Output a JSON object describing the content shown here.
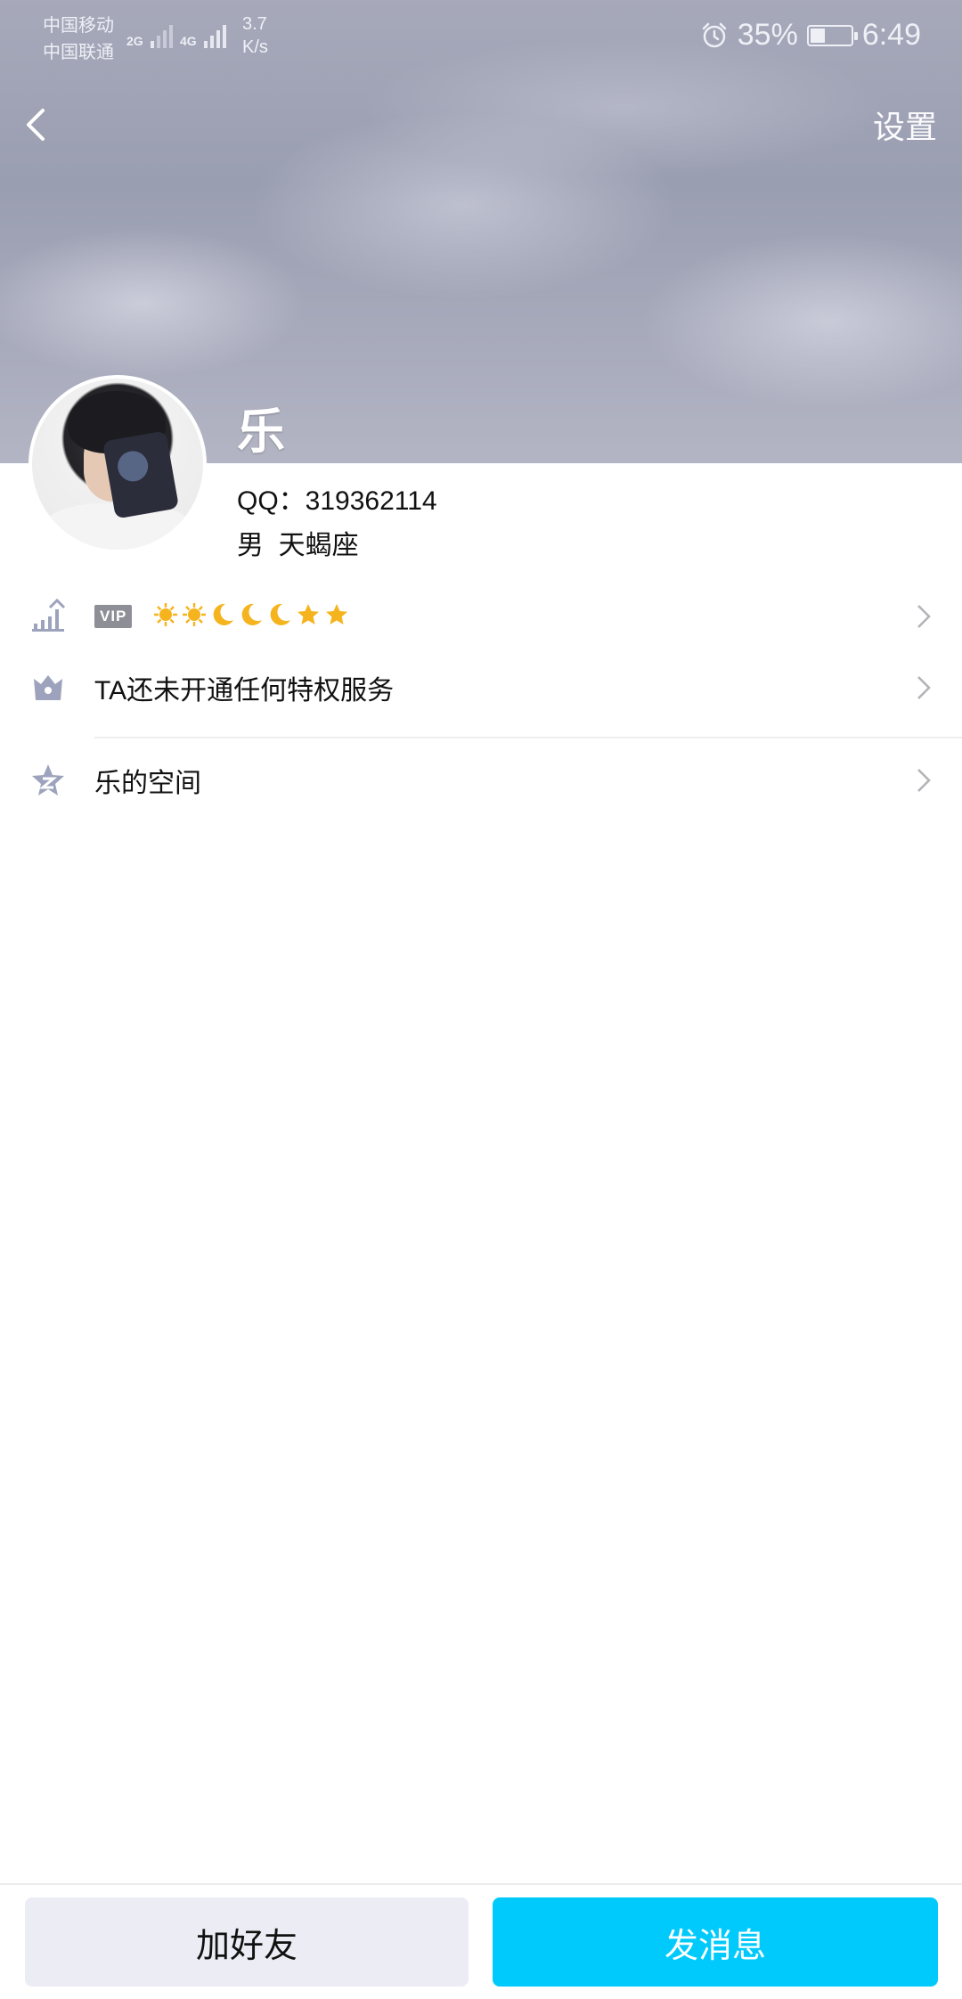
{
  "status_bar": {
    "carrier_1": "中国移动",
    "carrier_2": "中国联通",
    "net_1": "2G",
    "net_2": "4G",
    "speed_value": "3.7",
    "speed_unit": "K/s",
    "battery": "35%",
    "time": "6:49"
  },
  "header": {
    "back_icon": "chevron-left-icon",
    "settings_label": "设置"
  },
  "profile": {
    "name": "乐",
    "qq": "QQ：319362114",
    "gender": "男",
    "constellation": "天蝎座"
  },
  "rows": {
    "level": {
      "icon": "level-up-icon",
      "vip_label": "VIP",
      "badges": [
        "sun",
        "sun",
        "moon",
        "moon",
        "moon",
        "star",
        "star"
      ]
    },
    "privilege": {
      "icon": "crown-icon",
      "label": "TA还未开通任何特权服务"
    },
    "space": {
      "icon": "qzone-star-icon",
      "label": "乐的空间"
    }
  },
  "actions": {
    "add_friend": "加好友",
    "send_message": "发消息"
  },
  "colors": {
    "accent": "#00cafc",
    "secondary_button": "#ecedf4",
    "icon_gray": "#9ea3bd"
  }
}
